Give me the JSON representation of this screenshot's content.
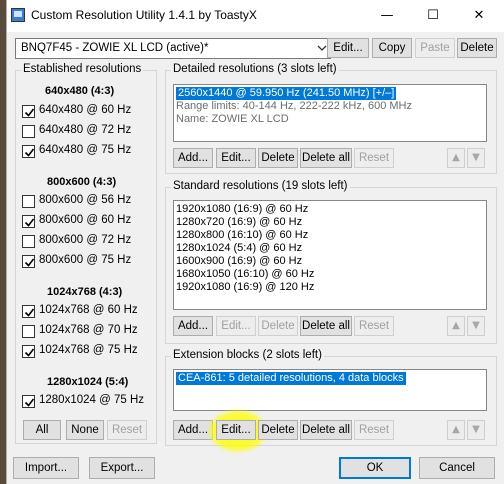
{
  "window": {
    "title": "Custom Resolution Utility 1.4.1 by ToastyX",
    "minimize_icon": "minimize-icon",
    "maximize_icon": "maximize-icon",
    "close_icon": "close-icon"
  },
  "toolbar": {
    "monitor": "BNQ7F45 - ZOWIE XL LCD (active)*",
    "edit": "Edit...",
    "copy": "Copy",
    "paste": "Paste",
    "delete": "Delete"
  },
  "established": {
    "title": "Established resolutions",
    "groups": [
      {
        "heading": "640x480 (4:3)",
        "items": [
          {
            "label": "640x480 @ 60 Hz",
            "checked": true
          },
          {
            "label": "640x480 @ 72 Hz",
            "checked": false
          },
          {
            "label": "640x480 @ 75 Hz",
            "checked": true
          }
        ]
      },
      {
        "heading": "800x600 (4:3)",
        "items": [
          {
            "label": "800x600 @ 56 Hz",
            "checked": false
          },
          {
            "label": "800x600 @ 60 Hz",
            "checked": true
          },
          {
            "label": "800x600 @ 72 Hz",
            "checked": false
          },
          {
            "label": "800x600 @ 75 Hz",
            "checked": true
          }
        ]
      },
      {
        "heading": "1024x768 (4:3)",
        "items": [
          {
            "label": "1024x768 @ 60 Hz",
            "checked": true
          },
          {
            "label": "1024x768 @ 70 Hz",
            "checked": false
          },
          {
            "label": "1024x768 @ 75 Hz",
            "checked": true
          }
        ]
      },
      {
        "heading": "1280x1024 (5:4)",
        "items": [
          {
            "label": "1280x1024 @ 75 Hz",
            "checked": true
          }
        ]
      }
    ],
    "all": "All",
    "none": "None",
    "reset": "Reset"
  },
  "detailed": {
    "title": "Detailed resolutions (3 slots left)",
    "lines": [
      "2560x1440 @ 59.950 Hz (241.50 MHz) [+/–]",
      "Range limits: 40-144 Hz, 222-222 kHz, 600 MHz",
      "Name: ZOWIE XL LCD"
    ],
    "add": "Add...",
    "edit": "Edit...",
    "delete": "Delete",
    "delete_all": "Delete all",
    "reset": "Reset"
  },
  "standard": {
    "title": "Standard resolutions (19 slots left)",
    "lines": [
      "1920x1080 (16:9) @ 60 Hz",
      "1280x720 (16:9) @ 60 Hz",
      "1280x800 (16:10) @ 60 Hz",
      "1280x1024 (5:4) @ 60 Hz",
      "1600x900 (16:9) @ 60 Hz",
      "1680x1050 (16:10) @ 60 Hz",
      "1920x1080 (16:9) @ 120 Hz"
    ],
    "add": "Add...",
    "edit": "Edit...",
    "delete": "Delete",
    "delete_all": "Delete all",
    "reset": "Reset"
  },
  "extension": {
    "title": "Extension blocks (2 slots left)",
    "lines": [
      "CEA-861: 5 detailed resolutions, 4 data blocks"
    ],
    "add": "Add...",
    "edit": "Edit...",
    "delete": "Delete",
    "delete_all": "Delete all",
    "reset": "Reset"
  },
  "footer": {
    "import": "Import...",
    "export": "Export...",
    "ok": "OK",
    "cancel": "Cancel"
  },
  "colors": {
    "selection": "#0078d7",
    "highlight": "#ffff00"
  }
}
